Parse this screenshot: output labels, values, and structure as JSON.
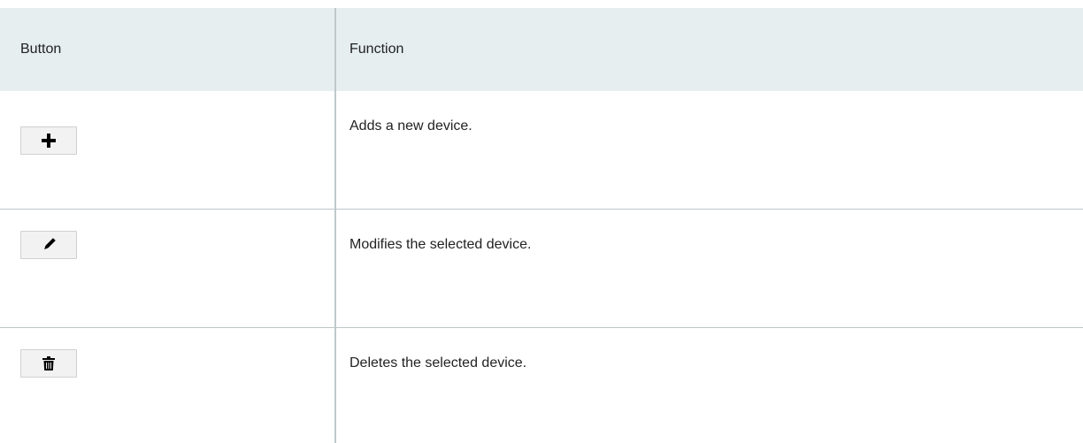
{
  "table": {
    "headers": {
      "button": "Button",
      "function": "Function"
    },
    "rows": [
      {
        "icon": "plus-icon",
        "function": "Adds a new device."
      },
      {
        "icon": "pencil-icon",
        "function": "Modifies the selected device."
      },
      {
        "icon": "trash-icon",
        "function": "Deletes the selected device."
      }
    ]
  }
}
